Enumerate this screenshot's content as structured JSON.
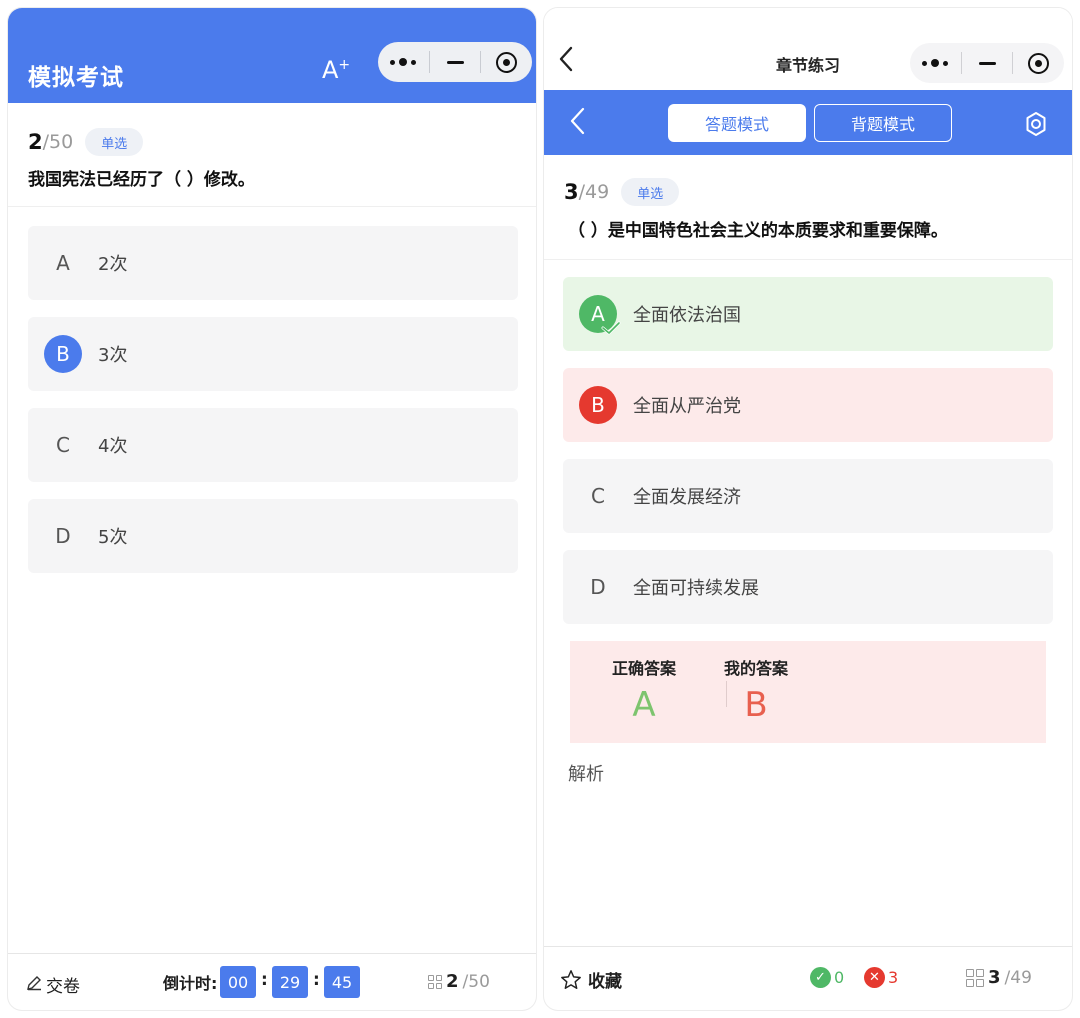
{
  "left": {
    "title": "模拟考试",
    "font_size_button": "A",
    "font_size_sup": "+",
    "question": {
      "current": "2",
      "total": "/50",
      "type": "单选",
      "text": "我国宪法已经历了（ ）修改。"
    },
    "options": [
      {
        "letter": "A",
        "text": "2次",
        "state": "normal"
      },
      {
        "letter": "B",
        "text": "3次",
        "state": "selected"
      },
      {
        "letter": "C",
        "text": "4次",
        "state": "normal"
      },
      {
        "letter": "D",
        "text": "5次",
        "state": "normal"
      }
    ],
    "footer": {
      "submit_label": "交卷",
      "countdown_label": "倒计时:",
      "hours": "00",
      "minutes": "29",
      "seconds": "45",
      "colon": ":",
      "progress_current": "2",
      "progress_total": "/50"
    }
  },
  "right": {
    "title": "章节练习",
    "modes": {
      "answer": "答题模式",
      "recite": "背题模式"
    },
    "question": {
      "current": "3",
      "total": "/49",
      "type": "单选",
      "text": "（ ）是中国特色社会主义的本质要求和重要保障。"
    },
    "options": [
      {
        "letter": "A",
        "text": "全面依法治国",
        "state": "correct"
      },
      {
        "letter": "B",
        "text": "全面从严治党",
        "state": "wrong"
      },
      {
        "letter": "C",
        "text": "全面发展经济",
        "state": "normal"
      },
      {
        "letter": "D",
        "text": "全面可持续发展",
        "state": "normal"
      }
    ],
    "result": {
      "correct_label": "正确答案",
      "correct_value": "A",
      "mine_label": "我的答案",
      "mine_value": "B"
    },
    "analysis_label": "解析",
    "footer": {
      "collect_label": "收藏",
      "correct_count": "0",
      "wrong_count": "3",
      "progress_current": "3",
      "progress_total": "/49"
    }
  },
  "colors": {
    "primary": "#4b7bec",
    "correct_bg": "#e8f6e6",
    "correct": "#4fb866",
    "wrong_bg": "#fdeaea",
    "wrong": "#e5392f",
    "option_bg": "#f5f5f6"
  },
  "icons": [
    "back-chevron-icon",
    "more-dots-icon",
    "minimize-icon",
    "close-target-icon",
    "settings-gear-icon",
    "edit-pencil-icon",
    "grid-icon",
    "star-icon",
    "check-circle-icon",
    "x-circle-icon"
  ]
}
